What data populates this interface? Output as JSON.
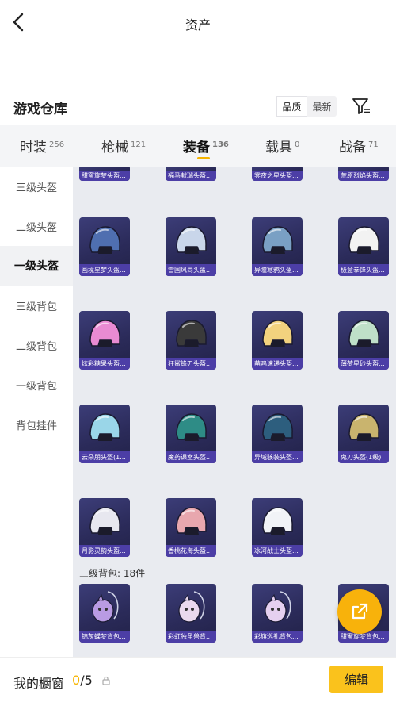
{
  "header": {
    "title": "资产"
  },
  "section": {
    "title": "游戏仓库",
    "sort_options": [
      "品质",
      "最新"
    ]
  },
  "tabs": [
    {
      "label": "时装",
      "count": "256"
    },
    {
      "label": "枪械",
      "count": "121"
    },
    {
      "label": "装备",
      "count": "136",
      "active": true
    },
    {
      "label": "载具",
      "count": "0"
    },
    {
      "label": "战备",
      "count": "71"
    }
  ],
  "sidebar": [
    {
      "label": "三级头盔"
    },
    {
      "label": "二级头盔"
    },
    {
      "label": "一级头盔",
      "active": true
    },
    {
      "label": "三级背包"
    },
    {
      "label": "二级背包"
    },
    {
      "label": "一级背包"
    },
    {
      "label": "背包挂件"
    }
  ],
  "top_row": [
    "甜蜜旋梦头盔...",
    "福马献瑞头盔...",
    "霁夜之星头盔...",
    "荒原烈焰头盔..."
  ],
  "items": [
    {
      "label": "画境星梦头盔...",
      "icon": "helmet-icon",
      "color": "#4f6fb0"
    },
    {
      "label": "雪国风尚头盔...",
      "icon": "helmet-icon",
      "color": "#c9d6ea"
    },
    {
      "label": "异瞳寒鸦头盔...",
      "icon": "helmet-icon",
      "color": "#7aa0c4"
    },
    {
      "label": "极意拳锋头盔...",
      "icon": "helmet-icon",
      "color": "#f2f2f2"
    },
    {
      "label": "炫彩糖果头盔...",
      "icon": "helmet-icon",
      "color": "#e98bd2"
    },
    {
      "label": "狂鲨锋刃头盔...",
      "icon": "helmet-icon",
      "color": "#3a3a3a"
    },
    {
      "label": "萌鸡速递头盔...",
      "icon": "helmet-icon",
      "color": "#f2d27e"
    },
    {
      "label": "薄荷星砂头盔...",
      "icon": "helmet-icon",
      "color": "#bfe0c8"
    },
    {
      "label": "云朵朋头盔(1...",
      "icon": "helmet-icon",
      "color": "#9ad6e8"
    },
    {
      "label": "魔药课室头盔...",
      "icon": "helmet-icon",
      "color": "#2e8c86"
    },
    {
      "label": "异域骇装头盔...",
      "icon": "helmet-icon",
      "color": "#2d5e7e"
    },
    {
      "label": "鬼刀头盔(1级)",
      "icon": "helmet-icon",
      "color": "#c9b46e"
    },
    {
      "label": "月影灵韵头盔...",
      "icon": "helmet-icon",
      "color": "#e7e7ef"
    },
    {
      "label": "香桃花海头盔...",
      "icon": "helmet-icon",
      "color": "#e8a7ae"
    },
    {
      "label": "冰河战士头盔...",
      "icon": "helmet-icon",
      "color": "#f1f3f7"
    }
  ],
  "sub_heading": "三级背包: 18件",
  "backpacks": [
    {
      "label": "锦灰蝶梦背包...",
      "icon": "backpack-icon",
      "color": "#b99be3"
    },
    {
      "label": "彩虹独角兽背...",
      "icon": "backpack-icon",
      "color": "#ead9ee"
    },
    {
      "label": "彩旗巡礼背包...",
      "icon": "backpack-icon",
      "color": "#e5d0f0"
    },
    {
      "label": "甜蜜旋梦背包...",
      "icon": "backpack-icon",
      "color": "#efa9c8"
    }
  ],
  "bottom": {
    "label": "我的橱窗",
    "used": "0",
    "total": "/5",
    "edit": "编辑"
  },
  "colors": {
    "accent": "#f6b400",
    "card_label": "#4c3ea6"
  }
}
